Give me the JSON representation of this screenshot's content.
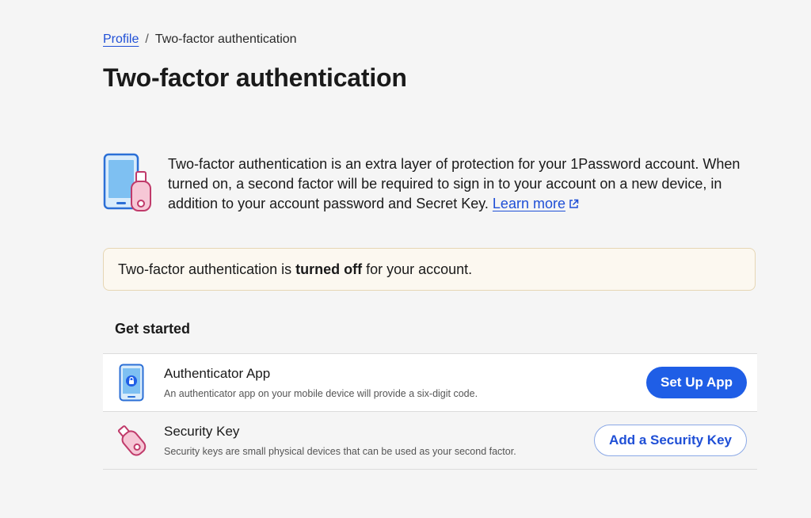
{
  "breadcrumb": {
    "parent": "Profile",
    "separator": "/",
    "current": "Two-factor authentication"
  },
  "page_title": "Two-factor authentication",
  "intro": {
    "text": "Two-factor authentication is an extra layer of protection for your 1Password account. When turned on, a second factor will be required to sign in to your account on a new device, in addition to your account password and Secret Key.",
    "link_label": "Learn more",
    "icon": "device-and-key-icon"
  },
  "status": {
    "prefix": "Two-factor authentication is ",
    "emphasis": "turned off",
    "suffix": " for your account."
  },
  "section_title": "Get started",
  "methods": [
    {
      "title": "Authenticator App",
      "description": "An authenticator app on your mobile device will provide a six-digit code.",
      "button": "Set Up App",
      "icon": "phone-lock-icon"
    },
    {
      "title": "Security Key",
      "description": "Security keys are small physical devices that can be used as your second factor.",
      "button": "Add a Security Key",
      "icon": "usb-key-icon"
    }
  ],
  "colors": {
    "link": "#1f4fd6",
    "primary_button": "#1f5ee6",
    "status_bg": "#fcf8f0",
    "status_border": "#e6d6b4"
  }
}
